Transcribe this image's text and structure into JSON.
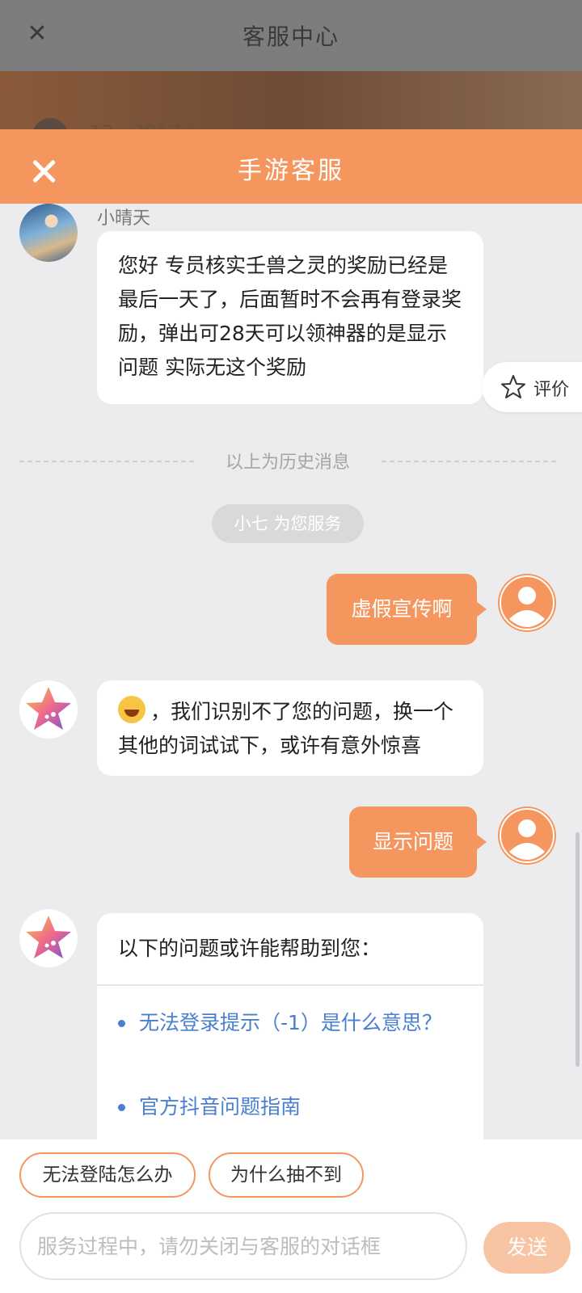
{
  "background_page": {
    "title": "客服中心",
    "banner_text": "13...79173"
  },
  "panel": {
    "title": "手游客服"
  },
  "history": {
    "agent_name": "小晴天",
    "agent_message": "您好 专员核实壬兽之灵的奖励已经是最后一天了，后面暂时不会再有登录奖励，弹出可28天可以领神器的是显示问题 实际无这个奖励",
    "divider": "以上为历史消息"
  },
  "rate": {
    "label": "评价"
  },
  "service_status": "小七 为您服务",
  "messages": [
    {
      "from": "user",
      "text": "虚假宣传啊"
    },
    {
      "from": "bot",
      "text": "，我们识别不了您的问题，换一个其他的词试试下，或许有意外惊喜"
    },
    {
      "from": "user",
      "text": "显示问题"
    }
  ],
  "suggestions": {
    "intro": "以下的问题或许能帮助到您：",
    "items": [
      "无法登录提示（-1）是什么意思？",
      "官方抖音问题指南"
    ]
  },
  "quick_replies": [
    "无法登陆怎么办",
    "为什么抽不到"
  ],
  "composer": {
    "placeholder": "服务过程中，请勿关闭与客服的对话框",
    "send_label": "发送"
  },
  "colors": {
    "accent": "#f5965e",
    "link": "#4a7fd0"
  }
}
